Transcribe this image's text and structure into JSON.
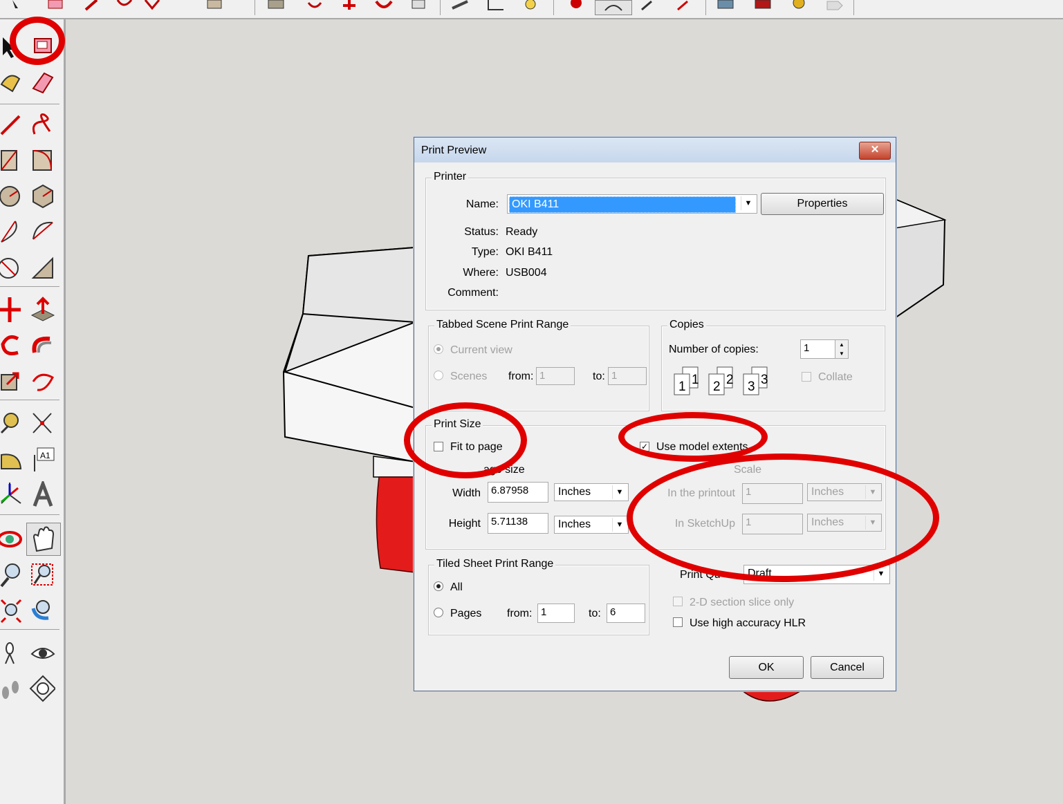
{
  "dialog": {
    "title": "Print Preview",
    "close_label": "✕",
    "printer": {
      "legend": "Printer",
      "name_label": "Name:",
      "name_value": "OKI B411",
      "properties_label": "Properties",
      "status_label": "Status:",
      "status_value": "Ready",
      "type_label": "Type:",
      "type_value": "OKI B411",
      "where_label": "Where:",
      "where_value": "USB004",
      "comment_label": "Comment:",
      "comment_value": ""
    },
    "scene_range": {
      "legend": "Tabbed Scene Print Range",
      "current_view_label": "Current view",
      "scenes_label": "Scenes",
      "from_label": "from:",
      "from_value": "1",
      "to_label": "to:",
      "to_value": "1"
    },
    "copies": {
      "legend": "Copies",
      "number_label": "Number of copies:",
      "number_value": "1",
      "collate_label": "Collate",
      "page_icons": [
        "1",
        "2",
        "3"
      ]
    },
    "print_size": {
      "legend": "Print Size",
      "fit_to_page_label": "Fit to page",
      "fit_to_page_checked": false,
      "use_model_extents_label": "Use model extents",
      "use_model_extents_checked": true,
      "page_size_label": "age size",
      "width_label": "Width",
      "width_value": "6.87958",
      "width_unit": "Inches",
      "height_label": "Height",
      "height_value": "5.71138",
      "height_unit": "Inches",
      "scale_label": "Scale",
      "in_printout_label": "In the printout",
      "in_printout_value": "1",
      "in_printout_unit": "Inches",
      "in_sketchup_label": "In SketchUp",
      "in_sketchup_value": "1",
      "in_sketchup_unit": "Inches"
    },
    "tiled_range": {
      "legend": "Tiled Sheet Print Range",
      "all_label": "All",
      "pages_label": "Pages",
      "from_label": "from:",
      "from_value": "1",
      "to_label": "to:",
      "to_value": "6"
    },
    "quality": {
      "label": "Print Qu",
      "value": "Draft",
      "section_slice_label": "2-D section slice only",
      "high_accuracy_label": "Use high accuracy HLR"
    },
    "ok_label": "OK",
    "cancel_label": "Cancel"
  },
  "colors": {
    "annotation_red": "#e00000",
    "model_red": "#e31b1b",
    "selection_blue": "#3399ff"
  },
  "toolbar_icons": [
    "select-icon",
    "print-preview-icon",
    "paint-bucket-icon",
    "eraser-icon",
    "pencil-icon",
    "freehand-icon",
    "rectangle-icon",
    "rotated-rectangle-icon",
    "circle-icon",
    "polygon-icon",
    "arc-icon",
    "pie-icon",
    "move-icon",
    "push-pull-icon",
    "rotate-icon",
    "follow-me-icon",
    "scale-icon",
    "offset-icon",
    "tape-measure-icon",
    "dimension-icon",
    "protractor-icon",
    "text-icon",
    "axes-icon",
    "3d-text-icon",
    "orbit-icon",
    "pan-icon",
    "zoom-icon",
    "zoom-window-icon",
    "zoom-extents-icon",
    "previous-view-icon",
    "position-camera-icon",
    "look-around-icon",
    "walk-icon",
    "section-plane-icon"
  ]
}
